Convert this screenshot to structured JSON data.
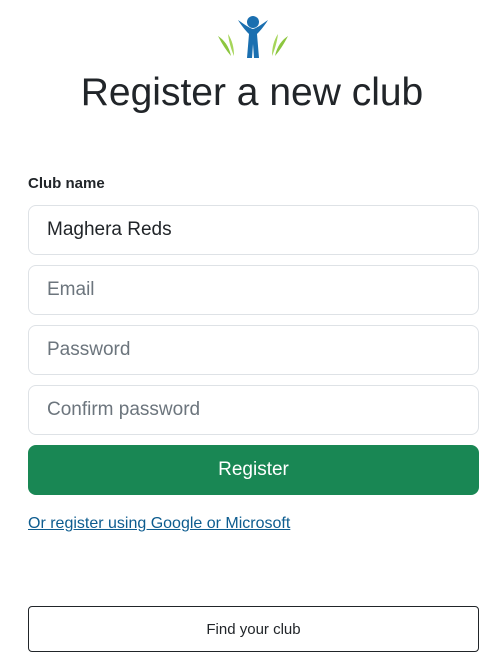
{
  "page": {
    "title": "Register a new club"
  },
  "logo": {
    "icon": "club-person-logo",
    "colors": {
      "figure": "#1a6fb0",
      "leaves": "#8cc63f"
    }
  },
  "form": {
    "club_name_label": "Club name",
    "club_name_value": "Maghera Reds",
    "email_placeholder": "Email",
    "password_placeholder": "Password",
    "confirm_password_placeholder": "Confirm password",
    "register_label": "Register",
    "alt_register_link": "Or register using Google or Microsoft"
  },
  "footer": {
    "find_club_label": "Find your club"
  },
  "colors": {
    "primary_button": "#198754",
    "link": "#0d5c8f",
    "border": "#dee2e6"
  }
}
